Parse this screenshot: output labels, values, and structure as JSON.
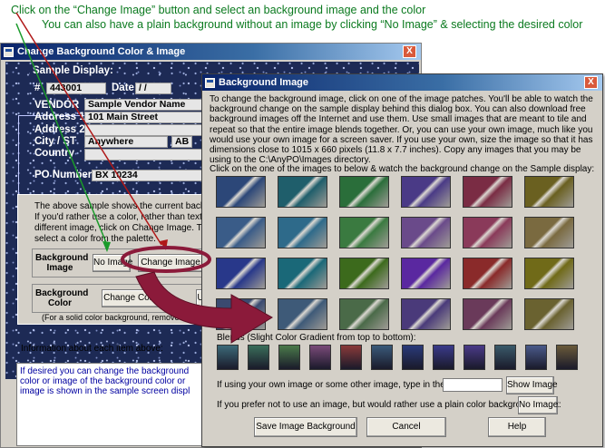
{
  "annotations": {
    "line1": "Click on the “Change Image” button and select an background image and the color",
    "line2": "You can also have a plain background without an image by clicking “No Image” & selecting the desired color"
  },
  "back_dialog": {
    "title": "Change Background Color & Image",
    "close": "X",
    "sample_display_label": "Sample Display:",
    "fields": {
      "number_label": "#",
      "number_value": "443001",
      "date_label": "Date",
      "date_value": "/   /",
      "vendor_label": "VENDOR",
      "vendor_value": "Sample Vendor Name",
      "address1_label": "Address 1",
      "address1_value": "101 Main Street",
      "address2_label": "Address 2",
      "city_label": "City / ST",
      "city_value": "Anywhere",
      "state_value": "AB",
      "country_label": "Country",
      "po_label": "PO Number",
      "po_value": "BX 10234"
    },
    "explain_lines": [
      "The above sample shows the current background",
      "If you'd rather use a color, rather than textured or",
      "different image, click on Change Image.  To chan",
      "select a color from the palette."
    ],
    "bg_image_label": "Background Image",
    "no_image_button": "No Image",
    "change_image_button": "Change Image",
    "bg_color_label": "Background Color",
    "change_color_button": "Change Color",
    "partial_button": "Us",
    "solid_note": "(For a solid color background, remove the image by cl",
    "info_label": "Information about each item above:",
    "info_text": "If desired you can change the background color or image of the background color or image is shown in the sample screen displ"
  },
  "front_dialog": {
    "title": "Background Image",
    "close": "X",
    "instructions": "To change the background image, click on one of the image patches.  You'll be able to watch the background change on the sample display behind this dialog box.  You can also download free background images off the Internet and use them.  Use small images that are meant to tile and repeat so that the entire image blends together.  Or, you can use your own image, much like you would use your own image for a screen saver.  If you use your own, size the image so that it has dimensions close to 1015 x 660 pixels (11.8 x 7.7 inches).  Copy any images that you may be using to the C:\\AnyPO\\Images directory.",
    "grid_label": "Click on the one of the images to below & watch the background change on the Sample display:",
    "tiles": [
      [
        "#2c4778",
        "#1f5e6b",
        "#2a6e3a",
        "#4a3a86",
        "#7a2c44",
        "#6a6020"
      ],
      [
        "#3a5c88",
        "#2e6a8a",
        "#3a7a40",
        "#6a4a8a",
        "#8a3a5a",
        "#7a6a40"
      ],
      [
        "#28388a",
        "#1a6878",
        "#3c6a1c",
        "#5a28a0",
        "#8a2a2a",
        "#706a18"
      ],
      [
        "#3a4a70",
        "#3e5a78",
        "#4a6a48",
        "#4a3a7a",
        "#6a3a5a",
        "#6a6230"
      ]
    ],
    "blend_label": "Blends (Slight Color Gradient from top to bottom):",
    "blends": [
      "#3c6a78",
      "#3a6e5a",
      "#4a7a4a",
      "#7a4a78",
      "#8a3a3a",
      "#3a5a7a",
      "#2a3a7a",
      "#3a3a8a",
      "#4a3a88",
      "#3a5a6a",
      "#4a5a8a",
      "#6a5a3a"
    ],
    "own_image_prompt": "If using your own image or some other image, type in the name:",
    "show_image_button": "Show Image",
    "plain_prompt": "If you prefer not to use an image, but would rather use a plain color background, click:",
    "no_image_button": "No Image",
    "save_button": "Save Image Background",
    "cancel_button": "Cancel",
    "help_button": "Help"
  },
  "colors": {
    "annotation_green": "#0b7a1f",
    "highlight_maroon": "#8b1a3a",
    "arrow_red": "#b01818",
    "arrow_green": "#1a9a2a"
  }
}
